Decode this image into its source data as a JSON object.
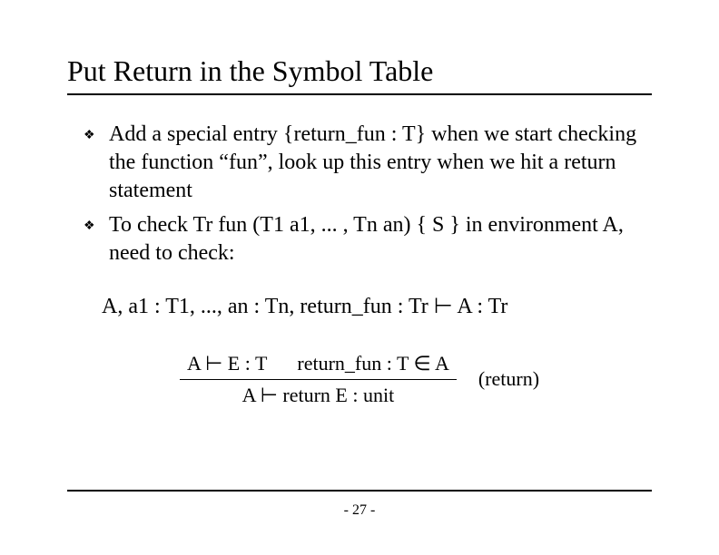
{
  "title": "Put Return in the Symbol Table",
  "bullets": [
    "Add a special entry {return_fun : T} when we start checking the function “fun”, look up this entry when we hit a return statement",
    "To check Tr fun (T1 a1, ... , Tn an) { S } in environment A, need to check:"
  ],
  "formula": "A, a1 : T1, ..., an : Tn, return_fun : Tr ⊢ A : Tr",
  "rule": {
    "top": "A ⊢ E : T      return_fun : T ∈ A",
    "bottom": "A ⊢ return E  : unit",
    "label": "(return)"
  },
  "page": "- 27 -"
}
